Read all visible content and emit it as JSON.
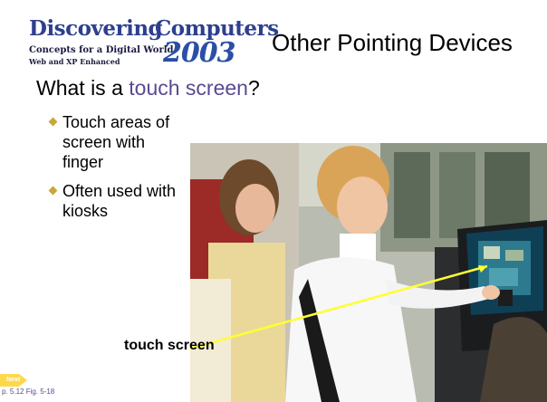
{
  "logo": {
    "word1": "Discovering",
    "word2": "Computers",
    "tagline": "Concepts for a Digital World",
    "edition": "Web and XP Enhanced",
    "year": "2003"
  },
  "slide": {
    "title": "Other Pointing Devices",
    "question_prefix": "What is a ",
    "question_term": "touch screen",
    "question_suffix": "?",
    "bullets": [
      "Touch areas of screen with finger",
      "Often used with kiosks"
    ],
    "callout_label": "touch screen"
  },
  "footer": {
    "next_label": "Next",
    "page_ref": "p. 5.12 Fig. 5-18"
  },
  "colors": {
    "highlight": "#5a4a93",
    "bullet": "#caa638",
    "arrow": "#ffff33",
    "next_button": "#ffd84a",
    "logo_blue": "#2d3f8e"
  }
}
